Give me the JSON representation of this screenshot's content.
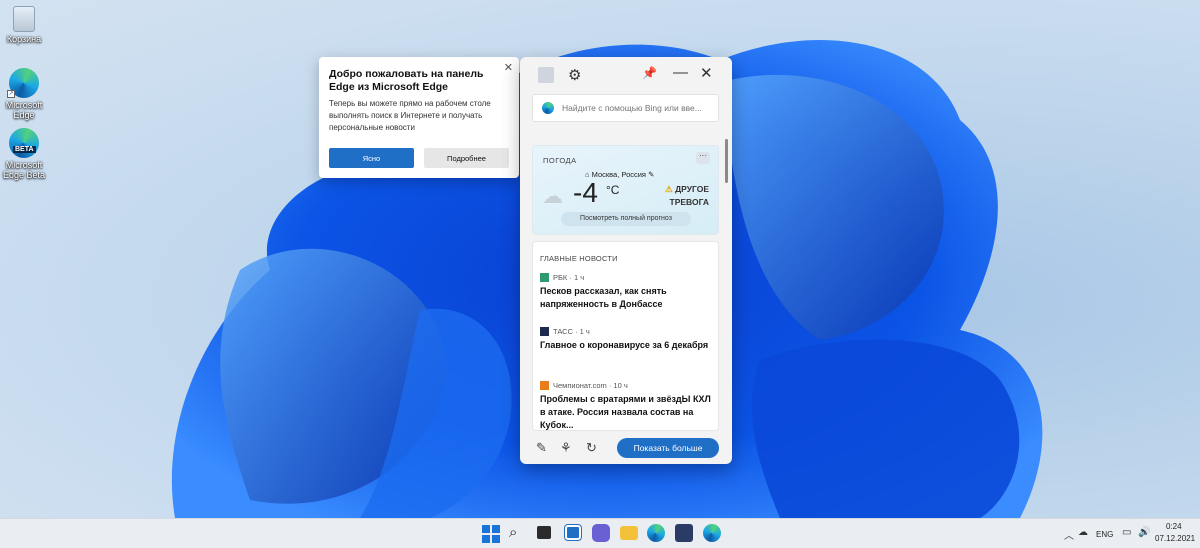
{
  "desktop": {
    "icons": [
      {
        "label": "Корзина"
      },
      {
        "label": "Microsoft Edge"
      },
      {
        "label": "Microsoft Edge Beta",
        "badge": "BETA"
      }
    ]
  },
  "welcome": {
    "title": "Добро пожаловать на панель Edge из Microsoft Edge",
    "body": "Теперь вы можете прямо на рабочем столе выполнять поиск в Интернете и получать персональные новости",
    "primary_label": "Ясно",
    "secondary_label": "Подробнее",
    "close_glyph": "✕"
  },
  "panel": {
    "search_placeholder": "Найдите с помощью Bing или вве...",
    "weather": {
      "label": "ПОГОДА",
      "more": "···",
      "location": "Москва, Россия",
      "temp": "-4",
      "unit": "°C",
      "alert_line1": "ДРУГОЕ",
      "alert_line2": "ТРЕВОГА",
      "forecast_label": "Посмотреть полный прогноз"
    },
    "news": {
      "heading": "ГЛАВНЫЕ НОВОСТИ",
      "items": [
        {
          "source": "РБК · 1 ч",
          "title": "Песков рассказал, как снять напряженность в Донбассе",
          "icon_color": "#2f9a6e"
        },
        {
          "source": "ТАСС · 1 ч",
          "title": "Главное о коронавирусе за 6 декабря",
          "icon_color": "#1c2a4d"
        },
        {
          "source": "Чемпионат.com · 10 ч",
          "title": "Проблемы с вратарями и звёздЫ КХЛ в атаке. Россия назвала состав на Кубок...",
          "icon_color": "#e87d1e"
        }
      ]
    },
    "show_more": "Показать больше"
  },
  "taskbar": {
    "language": "ENG",
    "time": "0:24",
    "date": "07.12.2021"
  },
  "colors": {
    "accent": "#1f6fc6",
    "taskbar": "#eaeef3"
  }
}
